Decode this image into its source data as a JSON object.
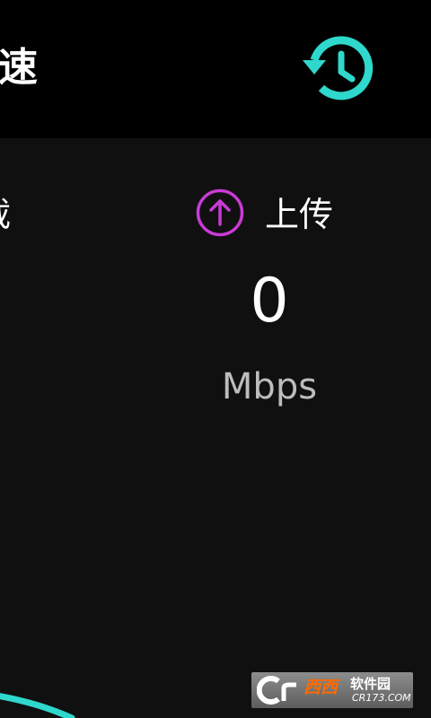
{
  "header": {
    "title_partial": "速",
    "history_button_icon": "history-icon",
    "accent_color": "#2fd8cc"
  },
  "download": {
    "label_partial": "载"
  },
  "upload": {
    "icon": "arrow-up-circle-icon",
    "icon_color": "#c93bd6",
    "label": "上传",
    "value": "0",
    "unit": "Mbps"
  },
  "watermark": {
    "logo": "Cr",
    "brand": "西西",
    "site": "软件园",
    "url": "CR173.COM"
  }
}
